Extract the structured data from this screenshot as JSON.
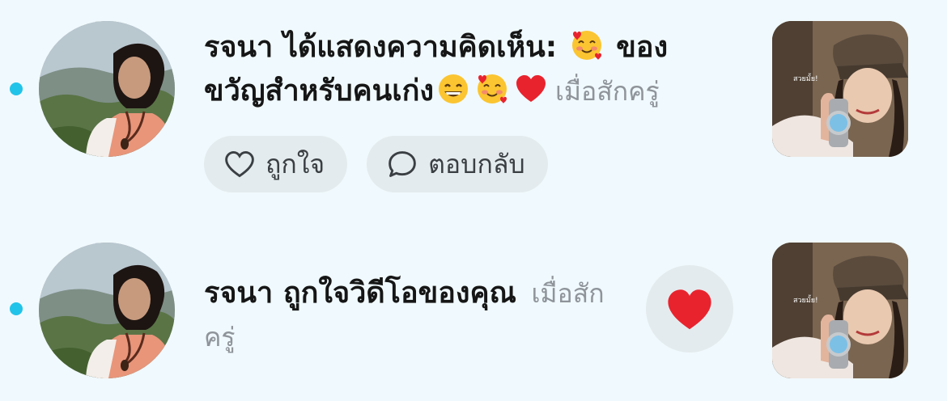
{
  "notifications": [
    {
      "unread": true,
      "user": "รจนา",
      "action_text": "ได้แสดงความคิดเห็น:",
      "comment_part1": "ของ",
      "comment_part2": "ขวัญสำหรับคนเก่ง",
      "time": "เมื่อสักครู่",
      "emojis": [
        "smiling-face-with-hearts",
        "grinning-face",
        "smiling-face-with-hearts",
        "red-heart"
      ],
      "like_label": "ถูกใจ",
      "reply_label": "ตอบกลับ",
      "thumbnail_caption": "สวยมั้ย!"
    },
    {
      "unread": true,
      "user": "รจนา",
      "action_text": "ถูกใจวิดีโอของคุณ",
      "time": "เมื่อสักครู่",
      "thumbnail_caption": "สวยมั้ย!",
      "reaction_icon": "red-heart"
    }
  ],
  "colors": {
    "background": "#f0f9fd",
    "unread_dot": "#22c3e8",
    "pill_bg": "#e4ebee",
    "time_text": "#8e949a",
    "heart": "#e8232e"
  }
}
